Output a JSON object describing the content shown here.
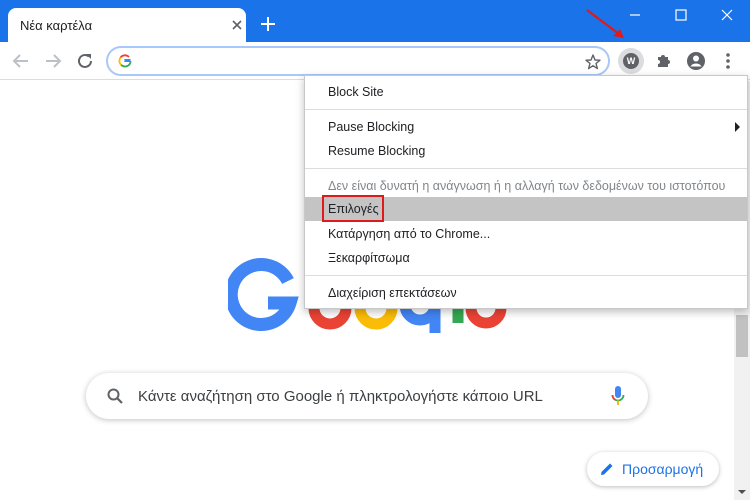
{
  "browser": {
    "tab_title": "Νέα καρτέλα",
    "extension_letter": "W"
  },
  "menu": {
    "items": [
      {
        "label": "Block Site"
      },
      {
        "label": "Pause Blocking"
      },
      {
        "label": "Resume Blocking"
      },
      {
        "label": "Δεν είναι δυνατή η ανάγνωση ή η αλλαγή των δεδομένων του ιστοτόπου"
      },
      {
        "label": "Επιλογές"
      },
      {
        "label": "Κατάργηση από το Chrome..."
      },
      {
        "label": "Ξεκαρφίτσωμα"
      },
      {
        "label": "Διαχείριση επεκτάσεων"
      }
    ]
  },
  "search": {
    "placeholder": "Κάντε αναζήτηση στο Google ή πληκτρολογήστε κάποιο URL"
  },
  "customize": {
    "label": "Προσαρμογή"
  },
  "colors": {
    "chrome_blue": "#1a73e8",
    "highlight": "#c4c4c4",
    "annotation_red": "#e01a1a"
  }
}
